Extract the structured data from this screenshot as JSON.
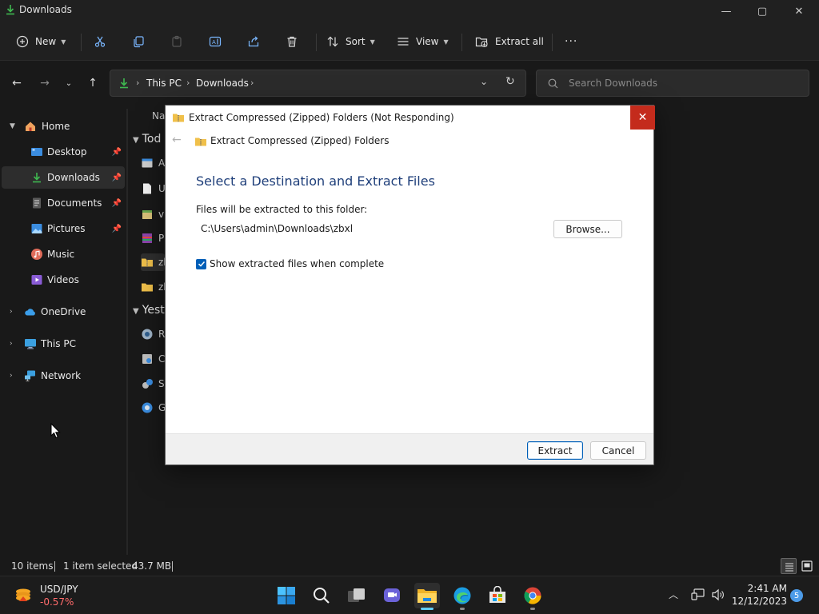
{
  "window": {
    "title": "Downloads",
    "controls": {
      "minimize": "—",
      "maximize": "▢",
      "close": "✕"
    }
  },
  "commandbar": {
    "new_label": "New",
    "sort_label": "Sort",
    "view_label": "View",
    "extract_all_label": "Extract all",
    "more_label": "···"
  },
  "address": {
    "crumbs": [
      "This PC",
      "Downloads"
    ],
    "search_placeholder": "Search Downloads"
  },
  "sidebar": {
    "items": [
      {
        "label": "Home"
      },
      {
        "label": "Desktop"
      },
      {
        "label": "Downloads"
      },
      {
        "label": "Documents"
      },
      {
        "label": "Pictures"
      },
      {
        "label": "Music"
      },
      {
        "label": "Videos"
      },
      {
        "label": "OneDrive"
      },
      {
        "label": "This PC"
      },
      {
        "label": "Network"
      }
    ]
  },
  "filelist": {
    "header_name": "Na",
    "group_today": "Tod",
    "group_yesterday": "Yest",
    "rows": [
      "A",
      "U",
      "v",
      "P",
      "zb",
      "zb",
      "R",
      "C",
      "S",
      "G"
    ]
  },
  "statusbar": {
    "items_count": "10 items",
    "selection": "1 item selected",
    "size": "43.7 MB"
  },
  "dialog": {
    "title": "Extract Compressed (Zipped) Folders (Not Responding)",
    "nav_title": "Extract Compressed (Zipped) Folders",
    "heading": "Select a Destination and Extract Files",
    "destination_label": "Files will be extracted to this folder:",
    "destination_path": "C:\\Users\\admin\\Downloads\\zbxl",
    "browse_label": "Browse...",
    "show_files_label": "Show extracted files when complete",
    "show_files_checked": true,
    "extract_label": "Extract",
    "cancel_label": "Cancel",
    "close_glyph": "✕"
  },
  "taskbar": {
    "widget_ticker": "USD/JPY",
    "widget_change": "-0.57%",
    "clock_time": "2:41 AM",
    "clock_date": "12/12/2023",
    "notification_count": "5"
  },
  "colors": {
    "accent": "#005fb8",
    "close_red": "#c42b1c",
    "heading_blue": "#1f3f7a",
    "negative": "#ff6b6b",
    "taskbar_active": "#60cdff"
  }
}
